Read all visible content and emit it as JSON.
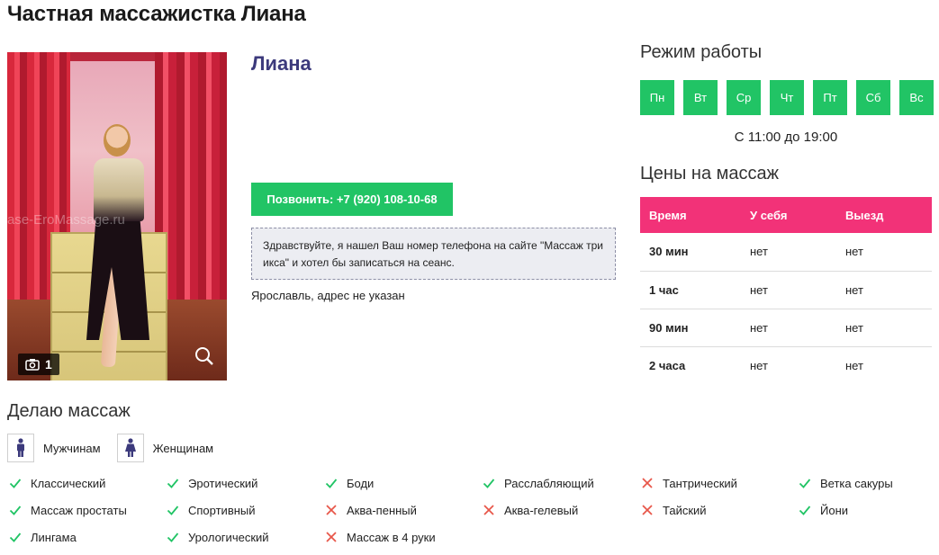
{
  "page": {
    "title": "Частная массажистка Лиана"
  },
  "profile": {
    "name": "Лиана",
    "call_button": "Позвонить: +7 (920) 108-10-68",
    "template_message": "Здравствуйте, я нашел Ваш номер телефона на сайте \"Массаж три икса\" и хотел бы записаться на сеанс.",
    "address": "Ярославль, адрес не указан"
  },
  "photo": {
    "count": "1",
    "watermark": "ase-EroMassage.ru",
    "icons": [
      "camera-icon",
      "zoom-icon"
    ]
  },
  "schedule": {
    "title": "Режим работы",
    "days": [
      "Пн",
      "Вт",
      "Ср",
      "Чт",
      "Пт",
      "Сб",
      "Вс"
    ],
    "hours": "С 11:00 до 19:00",
    "day_color": "#21c465"
  },
  "prices": {
    "title": "Цены на массаж",
    "header_color": "#f23278",
    "columns": [
      "Время",
      "У себя",
      "Выезд"
    ],
    "rows": [
      [
        "30 мин",
        "нет",
        "нет"
      ],
      [
        "1 час",
        "нет",
        "нет"
      ],
      [
        "90 мин",
        "нет",
        "нет"
      ],
      [
        "2 часа",
        "нет",
        "нет"
      ]
    ]
  },
  "massage": {
    "title": "Делаю массаж",
    "for_whom": [
      {
        "label": "Мужчинам",
        "icon": "male-icon"
      },
      {
        "label": "Женщинам",
        "icon": "female-icon"
      }
    ],
    "services": [
      {
        "label": "Классический",
        "available": true
      },
      {
        "label": "Эротический",
        "available": true
      },
      {
        "label": "Боди",
        "available": true
      },
      {
        "label": "Расслабляющий",
        "available": true
      },
      {
        "label": "Тантрический",
        "available": false
      },
      {
        "label": "Ветка сакуры",
        "available": true
      },
      {
        "label": "Массаж простаты",
        "available": true
      },
      {
        "label": "Спортивный",
        "available": true
      },
      {
        "label": "Аква-пенный",
        "available": false
      },
      {
        "label": "Аква-гелевый",
        "available": false
      },
      {
        "label": "Тайский",
        "available": false
      },
      {
        "label": "Йони",
        "available": true
      },
      {
        "label": "Лингама",
        "available": true
      },
      {
        "label": "Урологический",
        "available": true
      },
      {
        "label": "Массаж в 4 руки",
        "available": false
      }
    ],
    "check_color": "#21c465",
    "cross_color": "#e8564a"
  }
}
